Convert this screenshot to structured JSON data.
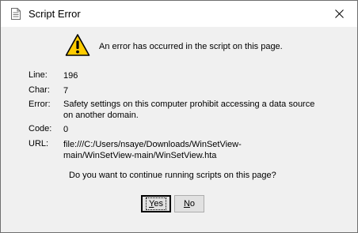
{
  "window": {
    "title": "Script Error"
  },
  "message": {
    "headline": "An error has occurred in the script on this page."
  },
  "details": {
    "line_label": "Line:",
    "line_value": "196",
    "char_label": "Char:",
    "char_value": "7",
    "error_label": "Error:",
    "error_value_1": "Safety settings on this computer prohibit accessing a data source",
    "error_value_2": "on another domain.",
    "code_label": "Code:",
    "code_value": "0",
    "url_label": "URL:",
    "url_value_1": "file:///C:/Users/nsaye/Downloads/WinSetView-",
    "url_value_2": "main/WinSetView-main/WinSetView.hta"
  },
  "question": "Do you want to continue running scripts on this page?",
  "buttons": {
    "yes_first": "Y",
    "yes_rest": "es",
    "no_first": "N",
    "no_rest": "o"
  },
  "icons": {
    "title": "script-document-icon",
    "warning": "warning-icon",
    "close": "close-icon"
  },
  "colors": {
    "warning_fill": "#ffcc00",
    "warning_border": "#000000",
    "dialog_bg": "#f0f0f0"
  }
}
